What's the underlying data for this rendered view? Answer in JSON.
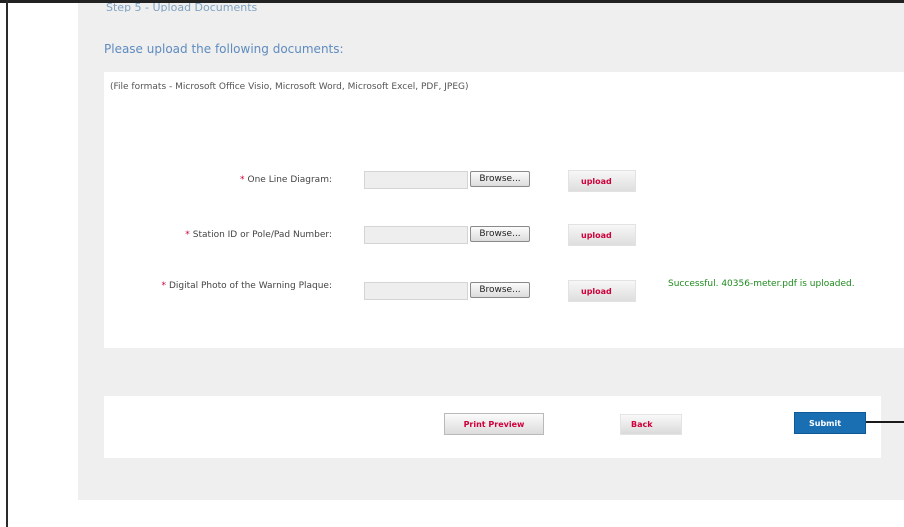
{
  "step_heading": "Step 5 - Upload Documents",
  "upload_title": "Please upload the following documents:",
  "file_formats": "(File formats - Microsoft Office Visio, Microsoft Word, Microsoft Excel, PDF, JPEG)",
  "required_marker": "*",
  "rows": [
    {
      "label": "One Line Diagram:",
      "browse": "Browse...",
      "upload": "upload"
    },
    {
      "label": "Station ID or Pole/Pad Number:",
      "browse": "Browse...",
      "upload": "upload"
    },
    {
      "label": "Digital Photo of the Warning Plaque:",
      "browse": "Browse...",
      "upload": "upload",
      "status": "Successful. 40356-meter.pdf is uploaded."
    }
  ],
  "actions": {
    "print_preview": "Print Preview",
    "back": "Back",
    "submit": "Submit"
  },
  "colors": {
    "accent_blue": "#1a6fb3",
    "required_red": "#d0003a",
    "success_green": "#1e8a1e",
    "heading_blue": "#5e8bbf"
  }
}
